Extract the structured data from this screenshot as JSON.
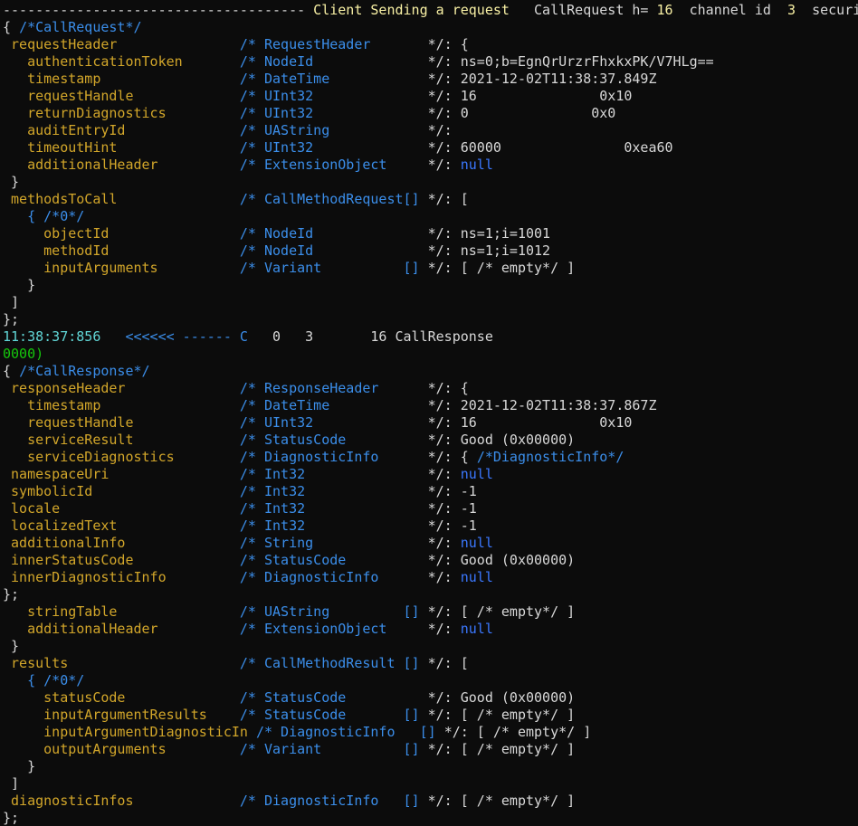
{
  "colors": {
    "background": "#0c0c0c",
    "default": "#d8d8d8",
    "field": "#d2a62a",
    "type": "#3b8eea",
    "log": "#16c60c",
    "timestamp": "#61d6d6",
    "header": "#f9f1a5",
    "null": "#3b78ff"
  },
  "lines": [
    [
      [
        "white",
        "------------------------------------- "
      ],
      [
        "yellow",
        "Client Sending a request   "
      ],
      [
        "white",
        "CallRequest h= "
      ],
      [
        "yellow",
        "16"
      ],
      [
        "white",
        "  channel id  "
      ],
      [
        "yellow",
        "3"
      ],
      [
        "white",
        "  security"
      ]
    ],
    [
      [
        "white",
        "{ "
      ],
      [
        "blue",
        "/*CallRequest*/"
      ]
    ],
    [
      [
        "white",
        " "
      ],
      [
        "gold",
        "requestHeader"
      ],
      [
        "white",
        "               "
      ],
      [
        "blue",
        "/* RequestHeader       "
      ],
      [
        "white",
        "*/: {"
      ]
    ],
    [
      [
        "white",
        "   "
      ],
      [
        "gold",
        "authenticationToken"
      ],
      [
        "white",
        "       "
      ],
      [
        "blue",
        "/* NodeId              "
      ],
      [
        "white",
        "*/: ns=0;b=EgnQrUrzrFhxkxPK/V7HLg=="
      ]
    ],
    [
      [
        "white",
        "   "
      ],
      [
        "gold",
        "timestamp"
      ],
      [
        "white",
        "                 "
      ],
      [
        "blue",
        "/* DateTime            "
      ],
      [
        "white",
        "*/: 2021-12-02T11:38:37.849Z"
      ]
    ],
    [
      [
        "white",
        "   "
      ],
      [
        "gold",
        "requestHandle"
      ],
      [
        "white",
        "             "
      ],
      [
        "blue",
        "/* UInt32              "
      ],
      [
        "white",
        "*/: 16               0x10"
      ]
    ],
    [
      [
        "white",
        "   "
      ],
      [
        "gold",
        "returnDiagnostics"
      ],
      [
        "white",
        "         "
      ],
      [
        "blue",
        "/* UInt32              "
      ],
      [
        "white",
        "*/: 0               0x0"
      ]
    ],
    [
      [
        "white",
        "   "
      ],
      [
        "gold",
        "auditEntryId"
      ],
      [
        "white",
        "              "
      ],
      [
        "blue",
        "/* UAString            "
      ],
      [
        "white",
        "*/:"
      ]
    ],
    [
      [
        "white",
        "   "
      ],
      [
        "gold",
        "timeoutHint"
      ],
      [
        "white",
        "               "
      ],
      [
        "blue",
        "/* UInt32              "
      ],
      [
        "white",
        "*/: 60000               0xea60"
      ]
    ],
    [
      [
        "white",
        "   "
      ],
      [
        "gold",
        "additionalHeader"
      ],
      [
        "white",
        "          "
      ],
      [
        "blue",
        "/* ExtensionObject     "
      ],
      [
        "white",
        "*/: "
      ],
      [
        "null",
        "null"
      ]
    ],
    [
      [
        "white",
        " }"
      ]
    ],
    [
      [
        "white",
        " "
      ],
      [
        "gold",
        "methodsToCall"
      ],
      [
        "white",
        "               "
      ],
      [
        "blue",
        "/* CallMethodRequest[] "
      ],
      [
        "white",
        "*/: ["
      ]
    ],
    [
      [
        "white",
        "   "
      ],
      [
        "blue",
        "{ /*0*/"
      ]
    ],
    [
      [
        "white",
        "     "
      ],
      [
        "gold",
        "objectId"
      ],
      [
        "white",
        "                "
      ],
      [
        "blue",
        "/* NodeId              "
      ],
      [
        "white",
        "*/: ns=1;i=1001"
      ]
    ],
    [
      [
        "white",
        "     "
      ],
      [
        "gold",
        "methodId"
      ],
      [
        "white",
        "                "
      ],
      [
        "blue",
        "/* NodeId              "
      ],
      [
        "white",
        "*/: ns=1;i=1012"
      ]
    ],
    [
      [
        "white",
        "     "
      ],
      [
        "gold",
        "inputArguments"
      ],
      [
        "white",
        "          "
      ],
      [
        "blue",
        "/* Variant          [] "
      ],
      [
        "white",
        "*/: [ /* empty*/ ]"
      ]
    ],
    [
      [
        "white",
        "   }"
      ]
    ],
    [
      [
        "white",
        " ]"
      ]
    ],
    [
      [
        "white",
        "};"
      ]
    ],
    [
      [
        "cyan",
        "11:38:37:856   "
      ],
      [
        "blue",
        "<<<<<< ------ C"
      ],
      [
        "white",
        "   0   3       16 CallResponse"
      ]
    ],
    [
      [
        "green",
        "0000)"
      ]
    ],
    [
      [
        "white",
        "{ "
      ],
      [
        "blue",
        "/*CallResponse*/"
      ]
    ],
    [
      [
        "white",
        " "
      ],
      [
        "gold",
        "responseHeader"
      ],
      [
        "white",
        "              "
      ],
      [
        "blue",
        "/* ResponseHeader      "
      ],
      [
        "white",
        "*/: {"
      ]
    ],
    [
      [
        "white",
        "   "
      ],
      [
        "gold",
        "timestamp"
      ],
      [
        "white",
        "                 "
      ],
      [
        "blue",
        "/* DateTime            "
      ],
      [
        "white",
        "*/: 2021-12-02T11:38:37.867Z"
      ]
    ],
    [
      [
        "white",
        "   "
      ],
      [
        "gold",
        "requestHandle"
      ],
      [
        "white",
        "             "
      ],
      [
        "blue",
        "/* UInt32              "
      ],
      [
        "white",
        "*/: 16               0x10"
      ]
    ],
    [
      [
        "white",
        "   "
      ],
      [
        "gold",
        "serviceResult"
      ],
      [
        "white",
        "             "
      ],
      [
        "blue",
        "/* StatusCode          "
      ],
      [
        "white",
        "*/: Good (0x00000)"
      ]
    ],
    [
      [
        "white",
        "   "
      ],
      [
        "gold",
        "serviceDiagnostics"
      ],
      [
        "white",
        "        "
      ],
      [
        "blue",
        "/* DiagnosticInfo      "
      ],
      [
        "white",
        "*/: { "
      ],
      [
        "blue",
        "/*DiagnosticInfo*/"
      ]
    ],
    [
      [
        "white",
        " "
      ],
      [
        "gold",
        "namespaceUri"
      ],
      [
        "white",
        "                "
      ],
      [
        "blue",
        "/* Int32               "
      ],
      [
        "white",
        "*/: "
      ],
      [
        "null",
        "null"
      ]
    ],
    [
      [
        "white",
        " "
      ],
      [
        "gold",
        "symbolicId"
      ],
      [
        "white",
        "                  "
      ],
      [
        "blue",
        "/* Int32               "
      ],
      [
        "white",
        "*/: -1"
      ]
    ],
    [
      [
        "white",
        " "
      ],
      [
        "gold",
        "locale"
      ],
      [
        "white",
        "                      "
      ],
      [
        "blue",
        "/* Int32               "
      ],
      [
        "white",
        "*/: -1"
      ]
    ],
    [
      [
        "white",
        " "
      ],
      [
        "gold",
        "localizedText"
      ],
      [
        "white",
        "               "
      ],
      [
        "blue",
        "/* Int32               "
      ],
      [
        "white",
        "*/: -1"
      ]
    ],
    [
      [
        "white",
        " "
      ],
      [
        "gold",
        "additionalInfo"
      ],
      [
        "white",
        "              "
      ],
      [
        "blue",
        "/* String              "
      ],
      [
        "white",
        "*/: "
      ],
      [
        "null",
        "null"
      ]
    ],
    [
      [
        "white",
        " "
      ],
      [
        "gold",
        "innerStatusCode"
      ],
      [
        "white",
        "             "
      ],
      [
        "blue",
        "/* StatusCode          "
      ],
      [
        "white",
        "*/: Good (0x00000)"
      ]
    ],
    [
      [
        "white",
        " "
      ],
      [
        "gold",
        "innerDiagnosticInfo"
      ],
      [
        "white",
        "         "
      ],
      [
        "blue",
        "/* DiagnosticInfo      "
      ],
      [
        "white",
        "*/: "
      ],
      [
        "null",
        "null"
      ]
    ],
    [
      [
        "white",
        "};"
      ]
    ],
    [
      [
        "white",
        "   "
      ],
      [
        "gold",
        "stringTable"
      ],
      [
        "white",
        "               "
      ],
      [
        "blue",
        "/* UAString         [] "
      ],
      [
        "white",
        "*/: [ /* empty*/ ]"
      ]
    ],
    [
      [
        "white",
        "   "
      ],
      [
        "gold",
        "additionalHeader"
      ],
      [
        "white",
        "          "
      ],
      [
        "blue",
        "/* ExtensionObject     "
      ],
      [
        "white",
        "*/: "
      ],
      [
        "null",
        "null"
      ]
    ],
    [
      [
        "white",
        " }"
      ]
    ],
    [
      [
        "white",
        " "
      ],
      [
        "gold",
        "results"
      ],
      [
        "white",
        "                     "
      ],
      [
        "blue",
        "/* CallMethodResult [] "
      ],
      [
        "white",
        "*/: ["
      ]
    ],
    [
      [
        "white",
        "   "
      ],
      [
        "blue",
        "{ /*0*/"
      ]
    ],
    [
      [
        "white",
        "     "
      ],
      [
        "gold",
        "statusCode"
      ],
      [
        "white",
        "              "
      ],
      [
        "blue",
        "/* StatusCode          "
      ],
      [
        "white",
        "*/: Good (0x00000)"
      ]
    ],
    [
      [
        "white",
        "     "
      ],
      [
        "gold",
        "inputArgumentResults"
      ],
      [
        "white",
        "    "
      ],
      [
        "blue",
        "/* StatusCode       [] "
      ],
      [
        "white",
        "*/: [ /* empty*/ ]"
      ]
    ],
    [
      [
        "white",
        "     "
      ],
      [
        "gold",
        "inputArgumentDiagnosticIn"
      ],
      [
        "white",
        " "
      ],
      [
        "blue",
        "/* DiagnosticInfo   [] "
      ],
      [
        "white",
        "*/: [ /* empty*/ ]"
      ]
    ],
    [
      [
        "white",
        "     "
      ],
      [
        "gold",
        "outputArguments"
      ],
      [
        "white",
        "         "
      ],
      [
        "blue",
        "/* Variant          [] "
      ],
      [
        "white",
        "*/: [ /* empty*/ ]"
      ]
    ],
    [
      [
        "white",
        "   }"
      ]
    ],
    [
      [
        "white",
        " ]"
      ]
    ],
    [
      [
        "white",
        " "
      ],
      [
        "gold",
        "diagnosticInfos"
      ],
      [
        "white",
        "             "
      ],
      [
        "blue",
        "/* DiagnosticInfo   [] "
      ],
      [
        "white",
        "*/: [ /* empty*/ ]"
      ]
    ],
    [
      [
        "white",
        "};"
      ]
    ]
  ]
}
